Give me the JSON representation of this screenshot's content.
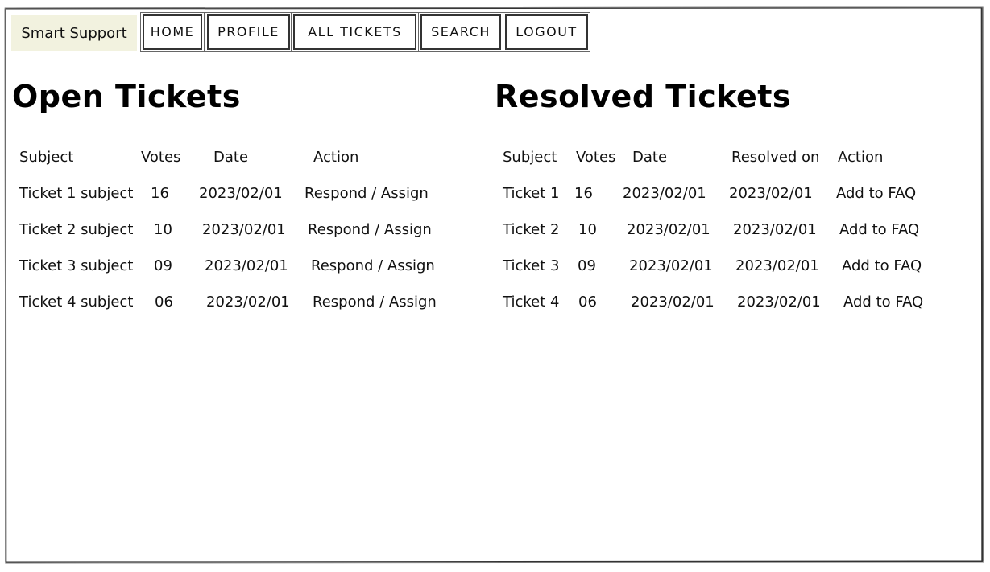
{
  "app": {
    "brand": "Smart Support"
  },
  "nav": {
    "home": "HOME",
    "profile": "PROFILE",
    "all_tickets": "ALL TICKETS",
    "search": "SEARCH",
    "logout": "LOGOUT"
  },
  "open_tickets": {
    "title": "Open Tickets",
    "columns": [
      "Subject",
      "Votes",
      "Date",
      "Action"
    ],
    "rows": [
      {
        "subject": "Ticket 1 subject",
        "votes": "16",
        "date": "2023/02/01",
        "action": "Respond / Assign"
      },
      {
        "subject": "Ticket 2 subject",
        "votes": "10",
        "date": "2023/02/01",
        "action": "Respond / Assign"
      },
      {
        "subject": "Ticket 3 subject",
        "votes": "09",
        "date": "2023/02/01",
        "action": "Respond / Assign"
      },
      {
        "subject": "Ticket 4 subject",
        "votes": "06",
        "date": "2023/02/01",
        "action": "Respond / Assign"
      }
    ]
  },
  "resolved_tickets": {
    "title": "Resolved Tickets",
    "columns": [
      "Subject",
      "Votes",
      "Date",
      "Resolved on",
      "Action"
    ],
    "rows": [
      {
        "subject": "Ticket 1",
        "votes": "16",
        "date": "2023/02/01",
        "resolved_on": "2023/02/01",
        "action": "Add to FAQ"
      },
      {
        "subject": "Ticket 2",
        "votes": "10",
        "date": "2023/02/01",
        "resolved_on": "2023/02/01",
        "action": "Add to FAQ"
      },
      {
        "subject": "Ticket 3",
        "votes": "09",
        "date": "2023/02/01",
        "resolved_on": "2023/02/01",
        "action": "Add to FAQ"
      },
      {
        "subject": "Ticket 4",
        "votes": "06",
        "date": "2023/02/01",
        "resolved_on": "2023/02/01",
        "action": "Add to FAQ"
      }
    ]
  }
}
